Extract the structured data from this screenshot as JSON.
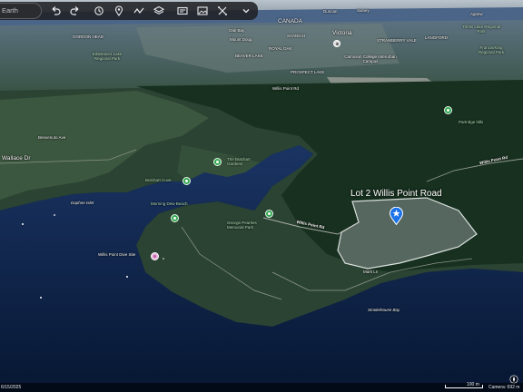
{
  "toolbar": {
    "search_value": "Earth",
    "icons": [
      "undo-icon",
      "redo-icon",
      "history-icon",
      "pin-icon",
      "path-icon",
      "layers-icon",
      "slideshow-icon",
      "image-icon",
      "measure-icon",
      "chevron-down-icon"
    ]
  },
  "places": {
    "canada": "CANADA",
    "top_city_a": "Duncan",
    "top_city_b": "Sidney",
    "agnew": "Agnew",
    "gordon_head": "GORDON HEAD",
    "oak_bay": "Oak Bay",
    "victoria": "Victoria",
    "mount_doug": "Mount Doug",
    "beaver_lake": "BEAVER LAKE",
    "royal_oak": "ROYAL OAK",
    "strawberry_vale": "STRAWBERRY VALE",
    "saanich": "SAANICH",
    "langford": "LANGFORD",
    "elk_lake_park": "Elk/Beaver Lake Regional Park",
    "camosun": "Camosun College Interurban Campus",
    "thetis": "Thetis Lake Regional Park",
    "francis_king": "Francis/King Regional Park",
    "prospect_lake": "PROSPECT LAKE",
    "willis_point_rd_top": "Willis Point Rd",
    "partridge_hills": "Partridge hills",
    "wallace_dr": "Wallace Dr",
    "benvenuto": "Benvenuto Ave",
    "butchart": "The Butchart Gardens",
    "butchart_cove": "Butchart Cove",
    "morning_dew": "Morning Dew Beach",
    "daphne_islet": "Daphne Islet",
    "willis_point_dive": "Willis Point Dive Site",
    "george_pearkes": "George Pearkes Memorial Park",
    "willis_point_rd_mid": "Willis Point Rd",
    "willis_point_rd_right": "Willis Point Rd",
    "smokehouse_bay": "Smokehouse Bay",
    "mark_ln": "Mark Ln",
    "lot_title": "Lot 2 Willis Point Road"
  },
  "status": {
    "date": "6/15/2025",
    "scale": "100 m",
    "camera": "Camera: 692 m"
  },
  "colors": {
    "water": "#0b1f45",
    "forest": "#1c3a2c",
    "land": "#3b5a3e",
    "lot_fill": "#6b7f74",
    "pin_green": "#34a853"
  }
}
